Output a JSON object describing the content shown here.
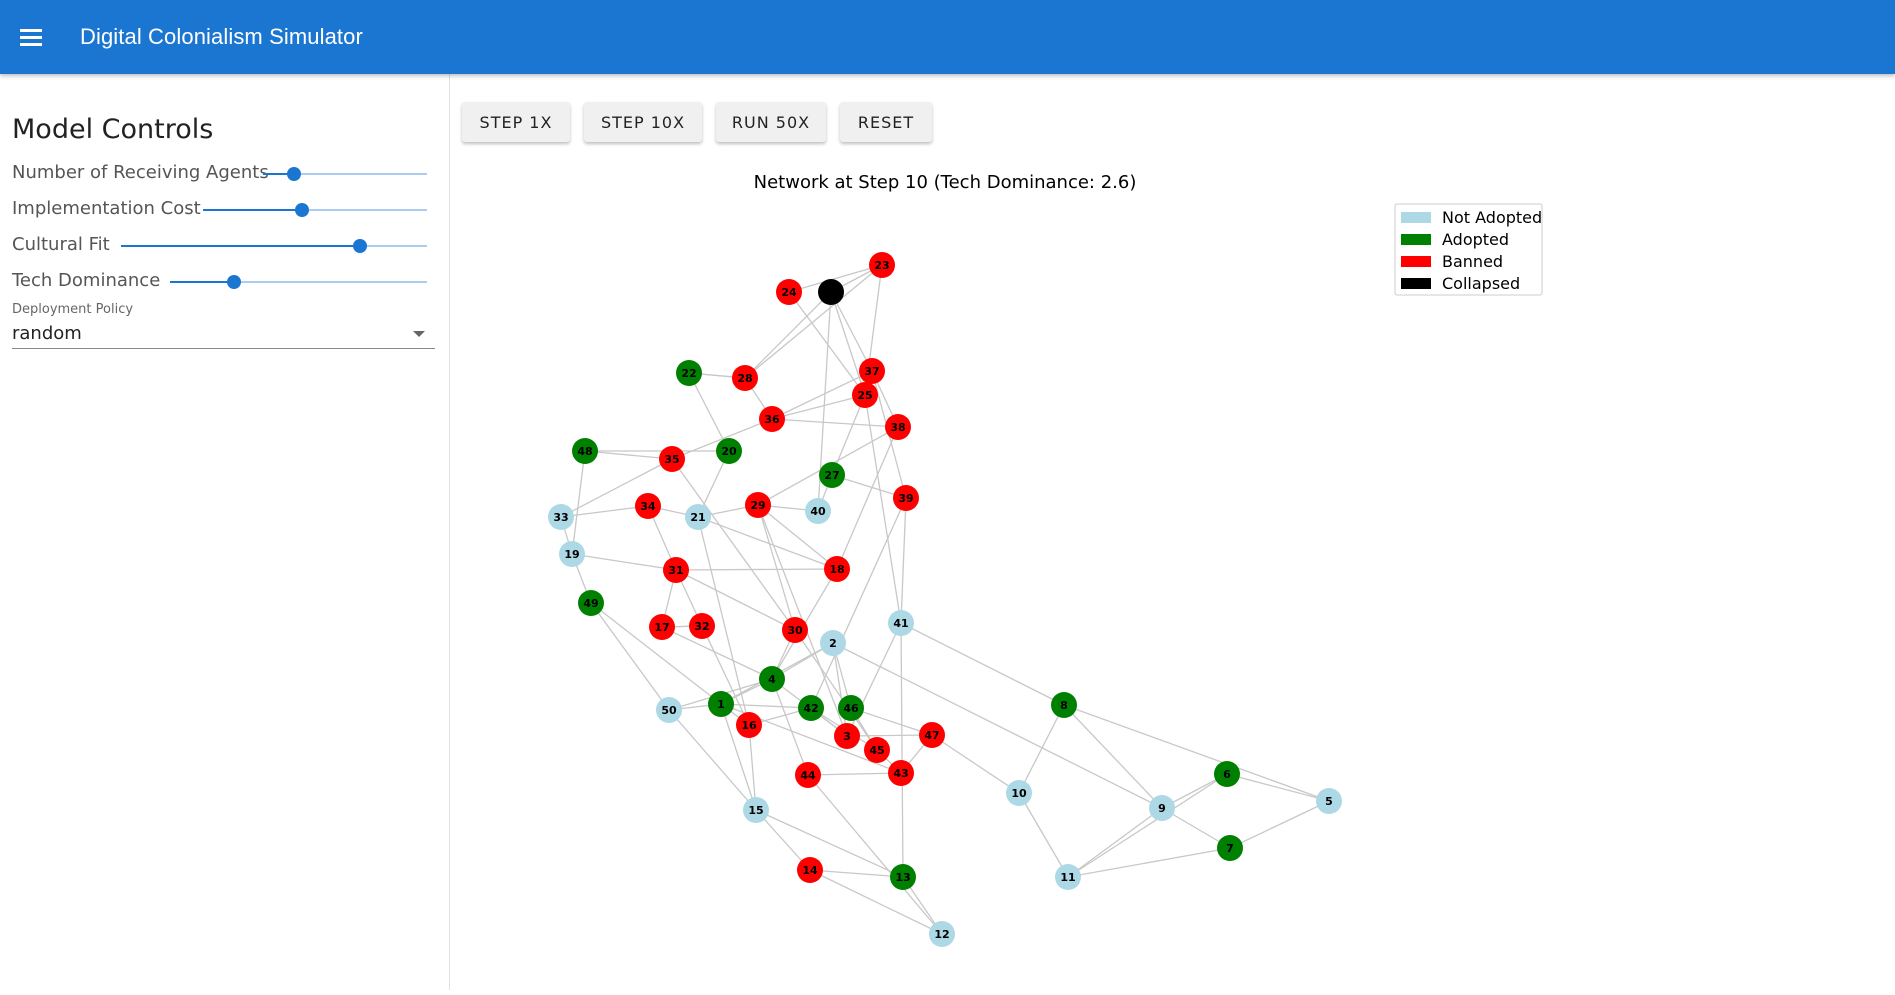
{
  "app": {
    "title": "Digital Colonialism Simulator",
    "menu_icon": "menu-icon"
  },
  "sidebar": {
    "title": "Model Controls",
    "sliders": [
      {
        "label": "Number of Receiving Agents",
        "value_fraction": 0.19
      },
      {
        "label": "Implementation Cost",
        "value_fraction": 0.44
      },
      {
        "label": "Cultural Fit",
        "value_fraction": 0.78
      },
      {
        "label": "Tech Dominance",
        "value_fraction": 0.25
      }
    ],
    "deployment_policy": {
      "label": "Deployment Policy",
      "value": "random"
    }
  },
  "toolbar": {
    "step1_label": "STEP 1X",
    "step10_label": "STEP 10X",
    "run50_label": "RUN 50X",
    "reset_label": "RESET"
  },
  "chart_data": {
    "type": "network",
    "title": "Network at Step 10 (Tech Dominance: 2.6)",
    "legend": [
      {
        "label": "Not Adopted",
        "color": "#add8e6"
      },
      {
        "label": "Adopted",
        "color": "#008000"
      },
      {
        "label": "Banned",
        "color": "#ff0000"
      },
      {
        "label": "Collapsed",
        "color": "#000000"
      }
    ],
    "legend_position": "top-right",
    "nodes": [
      {
        "id": "1",
        "state": "Adopted"
      },
      {
        "id": "2",
        "state": "Not Adopted"
      },
      {
        "id": "3",
        "state": "Banned"
      },
      {
        "id": "4",
        "state": "Adopted"
      },
      {
        "id": "5",
        "state": "Not Adopted"
      },
      {
        "id": "6",
        "state": "Adopted"
      },
      {
        "id": "7",
        "state": "Adopted"
      },
      {
        "id": "8",
        "state": "Adopted"
      },
      {
        "id": "9",
        "state": "Not Adopted"
      },
      {
        "id": "10",
        "state": "Not Adopted"
      },
      {
        "id": "11",
        "state": "Not Adopted"
      },
      {
        "id": "12",
        "state": "Not Adopted"
      },
      {
        "id": "13",
        "state": "Adopted"
      },
      {
        "id": "14",
        "state": "Banned"
      },
      {
        "id": "15",
        "state": "Not Adopted"
      },
      {
        "id": "16",
        "state": "Banned"
      },
      {
        "id": "17",
        "state": "Banned"
      },
      {
        "id": "18",
        "state": "Banned"
      },
      {
        "id": "19",
        "state": "Not Adopted"
      },
      {
        "id": "20",
        "state": "Adopted"
      },
      {
        "id": "21",
        "state": "Not Adopted"
      },
      {
        "id": "22",
        "state": "Adopted"
      },
      {
        "id": "23",
        "state": "Banned"
      },
      {
        "id": "24",
        "state": "Banned"
      },
      {
        "id": "",
        "state": "Collapsed"
      },
      {
        "id": "25",
        "state": "Banned"
      },
      {
        "id": "27",
        "state": "Adopted"
      },
      {
        "id": "28",
        "state": "Banned"
      },
      {
        "id": "29",
        "state": "Banned"
      },
      {
        "id": "30",
        "state": "Banned"
      },
      {
        "id": "31",
        "state": "Banned"
      },
      {
        "id": "32",
        "state": "Banned"
      },
      {
        "id": "33",
        "state": "Not Adopted"
      },
      {
        "id": "34",
        "state": "Banned"
      },
      {
        "id": "35",
        "state": "Banned"
      },
      {
        "id": "36",
        "state": "Banned"
      },
      {
        "id": "37",
        "state": "Banned"
      },
      {
        "id": "38",
        "state": "Banned"
      },
      {
        "id": "39",
        "state": "Banned"
      },
      {
        "id": "40",
        "state": "Not Adopted"
      },
      {
        "id": "41",
        "state": "Not Adopted"
      },
      {
        "id": "42",
        "state": "Adopted"
      },
      {
        "id": "43",
        "state": "Banned"
      },
      {
        "id": "44",
        "state": "Banned"
      },
      {
        "id": "45",
        "state": "Banned"
      },
      {
        "id": "46",
        "state": "Adopted"
      },
      {
        "id": "47",
        "state": "Banned"
      },
      {
        "id": "48",
        "state": "Adopted"
      },
      {
        "id": "49",
        "state": "Adopted"
      },
      {
        "id": "50",
        "state": "Not Adopted"
      }
    ]
  }
}
